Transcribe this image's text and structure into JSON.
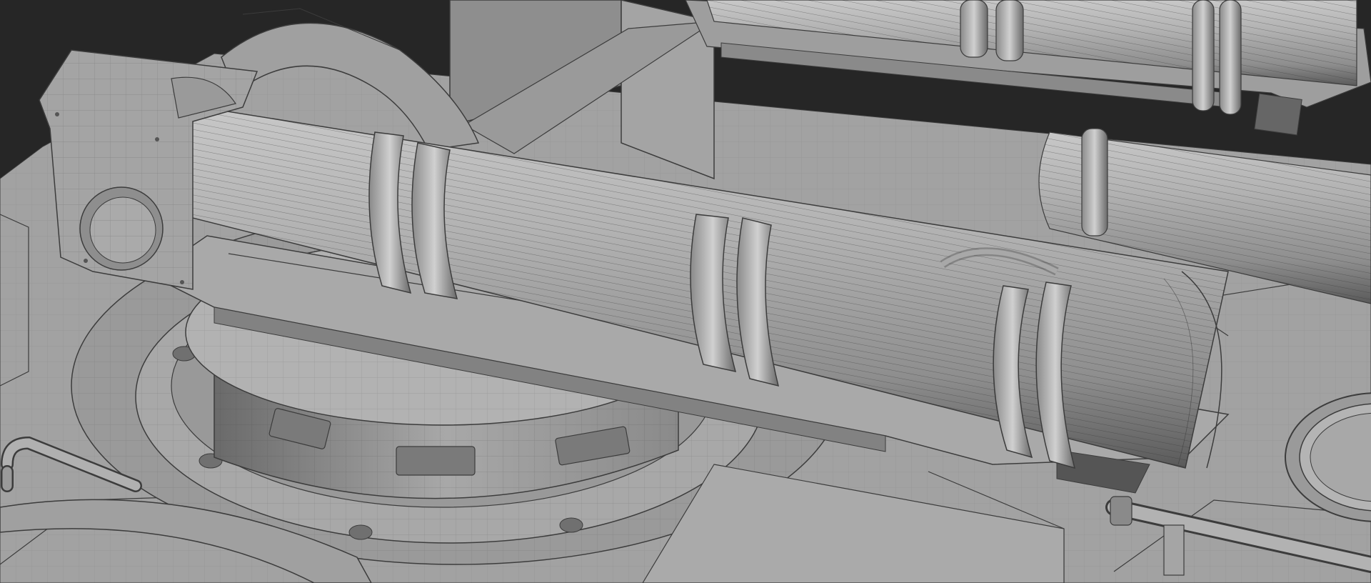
{
  "scene": {
    "kind": "3d-wireframe-viewport",
    "subject": "turret-model",
    "colors": {
      "background": "#262626",
      "base_fill": "#9c9c9c",
      "plate_fill": "#a6a6a6",
      "barrel_fill": "#a9a9a9",
      "shadow_fill": "#6f6f6f",
      "dark_fill": "#555555",
      "edge_line": "#3c3c3c"
    }
  }
}
